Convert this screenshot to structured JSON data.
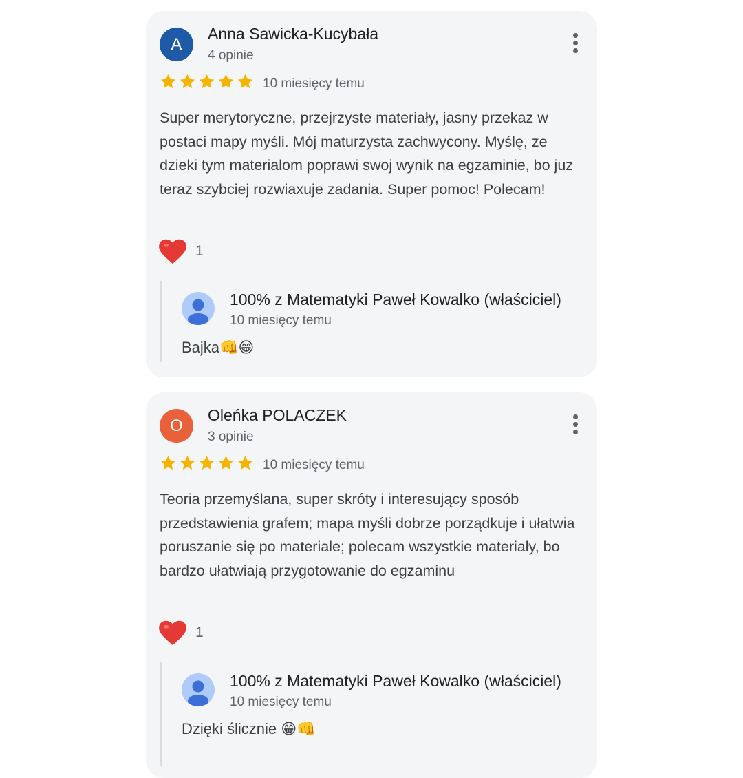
{
  "colors": {
    "star": "#f4b400",
    "heart": "#e53935",
    "avatar_a": "#1e5aa8",
    "avatar_o": "#e8613a"
  },
  "icons": {
    "rating_star": "star-icon",
    "like": "heart-icon",
    "menu": "more-vert-icon",
    "owner_avatar": "person-icon"
  },
  "reviews": [
    {
      "avatar_letter": "A",
      "author": "Anna Sawicka-Kucybała",
      "review_count": "4 opinie",
      "rating": 5,
      "date": "10 miesięcy temu",
      "text": "Super merytoryczne, przejrzyste materiały, jasny przekaz w postaci mapy myśli. Mój maturzysta zachwycony. Myślę, ze dzieki tym materialom poprawi swoj wynik na egzaminie, bo juz teraz szybciej rozwiaxuje zadania. Super pomoc! Polecam!",
      "likes": "1",
      "reply": {
        "author": "100% z Matematyki Paweł Kowalko (właściciel)",
        "date": "10 miesięcy temu",
        "text": "Bajka👊😁"
      }
    },
    {
      "avatar_letter": "O",
      "author": "Oleńka POLACZEK",
      "review_count": "3 opinie",
      "rating": 5,
      "date": "10 miesięcy temu",
      "text": "Teoria przemyślana, super skróty i interesujący sposób przedstawienia grafem; mapa myśli dobrze porządkuje i ułatwia poruszanie się po materiale; polecam wszystkie materiały, bo bardzo ułatwiają przygotowanie do egzaminu",
      "likes": "1",
      "reply": {
        "author": "100% z Matematyki Paweł Kowalko (właściciel)",
        "date": "10 miesięcy temu",
        "text": "Dzięki ślicznie 😁👊"
      }
    }
  ]
}
